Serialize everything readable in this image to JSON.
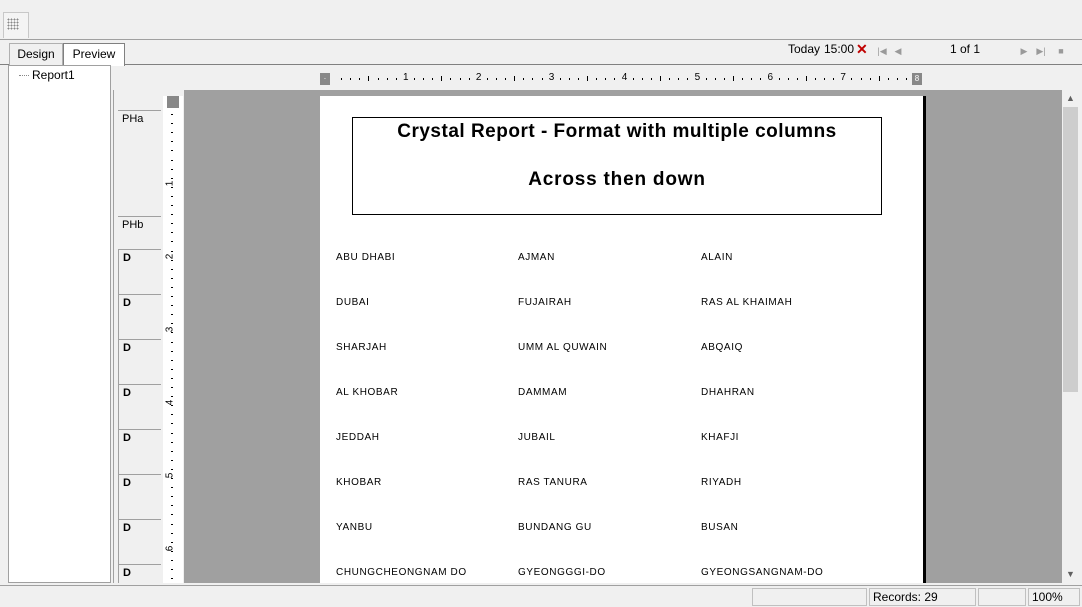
{
  "toolbar": {
    "grip_icon": "toolbar-grip-icon"
  },
  "tabs": {
    "design": "Design",
    "preview": "Preview"
  },
  "navigation": {
    "today": "Today",
    "time": "15:00",
    "close": "✕",
    "page_count": "1 of 1"
  },
  "tree": {
    "root": "Report1"
  },
  "sections": {
    "pha": "PHa",
    "phb": "PHb",
    "detail": "D"
  },
  "ruler": {
    "h_numbers": [
      "1",
      "2",
      "3",
      "4",
      "5",
      "6",
      "7",
      "8"
    ],
    "v_numbers": [
      "1",
      "2",
      "3",
      "4",
      "5",
      "6"
    ]
  },
  "report": {
    "title_line1": "Crystal Report - Format with multiple columns",
    "title_line2": "Across then down",
    "rows": [
      [
        "ABU DHABI",
        "AJMAN",
        "ALAIN"
      ],
      [
        "DUBAI",
        "FUJAIRAH",
        "RAS AL KHAIMAH"
      ],
      [
        "SHARJAH",
        "UMM AL QUWAIN",
        "ABQAIQ"
      ],
      [
        "AL KHOBAR",
        "DAMMAM",
        "DHAHRAN"
      ],
      [
        "JEDDAH",
        "JUBAIL",
        "KHAFJI"
      ],
      [
        "KHOBAR",
        "RAS TANURA",
        "RIYADH"
      ],
      [
        "YANBU",
        "BUNDANG GU",
        "BUSAN"
      ],
      [
        "CHUNGCHEONGNAM DO",
        "GYEONGGGI-DO",
        "GYEONGSANGNAM-DO"
      ]
    ]
  },
  "status": {
    "records": "Records:  29",
    "zoom": "100%"
  }
}
